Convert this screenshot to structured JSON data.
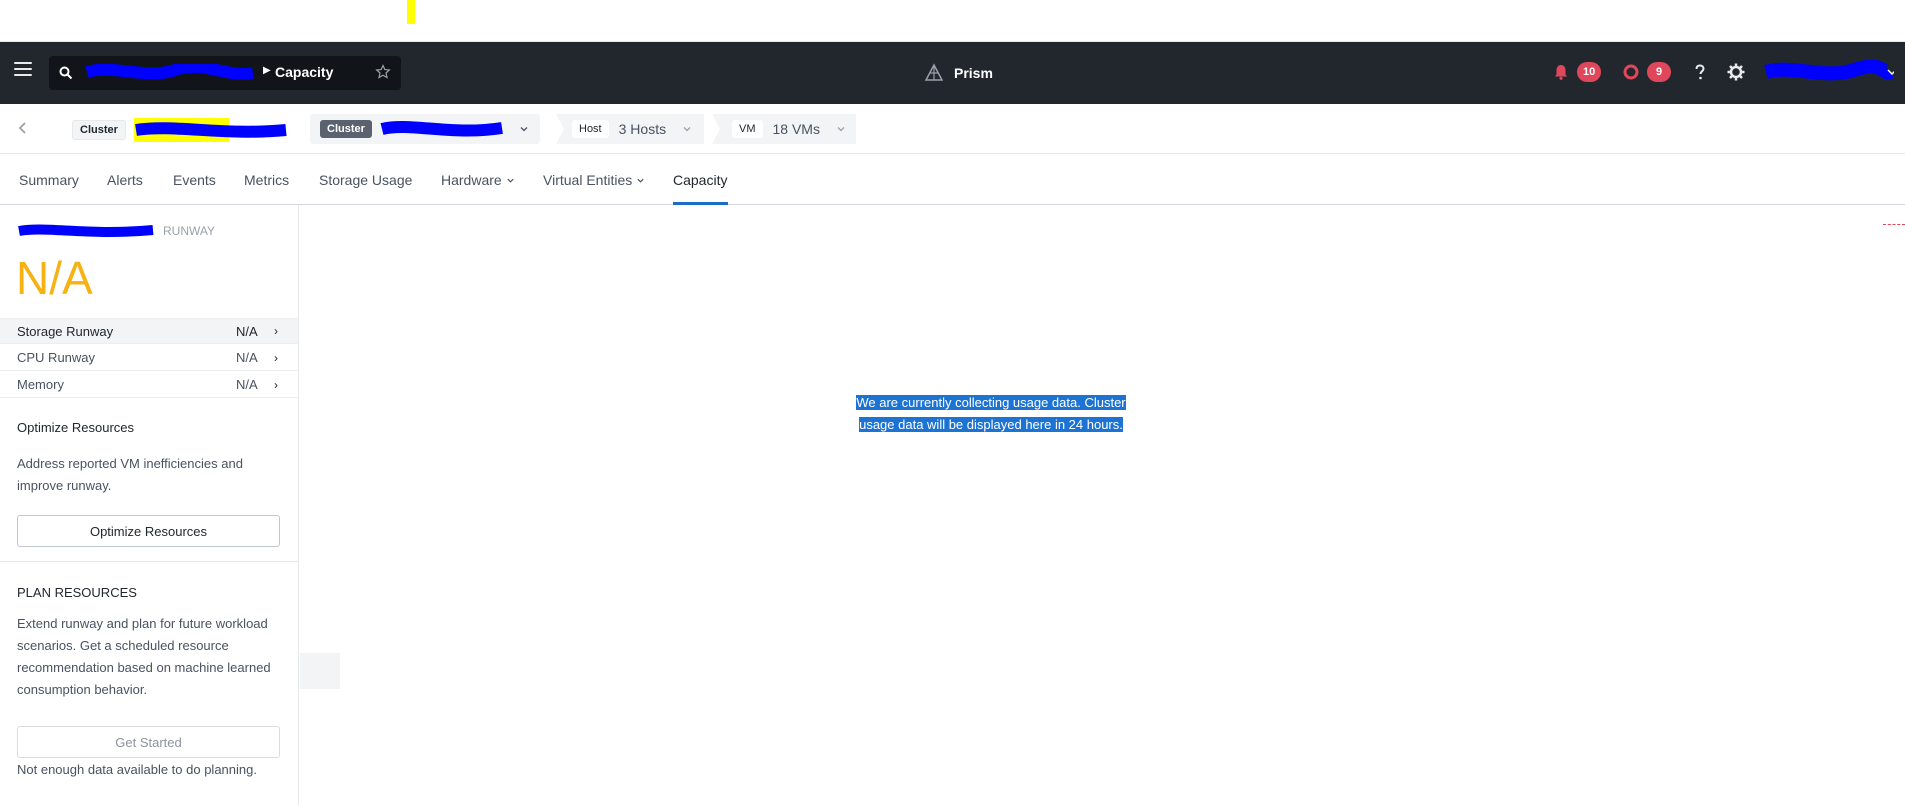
{
  "header": {
    "search_crumb": "Capacity",
    "brand": "Prism",
    "alerts_count": "10",
    "events_count": "9"
  },
  "entity_bar": {
    "cluster_label": "Cluster",
    "cluster2_label": "Cluster",
    "host_label": "Host",
    "host_value": "3 Hosts",
    "vm_label": "VM",
    "vm_value": "18 VMs"
  },
  "tabs": [
    {
      "label": "Summary"
    },
    {
      "label": "Alerts"
    },
    {
      "label": "Events"
    },
    {
      "label": "Metrics"
    },
    {
      "label": "Storage Usage"
    },
    {
      "label": "Hardware"
    },
    {
      "label": "Virtual Entities"
    },
    {
      "label": "Capacity",
      "active": true
    }
  ],
  "left_panel": {
    "runway_title": "RUNWAY",
    "runway_value": "N/A",
    "rows": [
      {
        "label": "Storage Runway",
        "value": "N/A"
      },
      {
        "label": "CPU Runway",
        "value": "N/A"
      },
      {
        "label": "Memory",
        "value": "N/A"
      }
    ],
    "optimize": {
      "title": "Optimize Resources",
      "text": "Address reported VM inefficiencies and improve runway.",
      "button": "Optimize Resources"
    },
    "plan": {
      "title": "PLAN RESOURCES",
      "text": "Extend runway and plan for future workload scenarios. Get a scheduled resource recommendation based on machine learned consumption behavior.",
      "button": "Get Started",
      "note": "Not enough data available to do planning."
    }
  },
  "main": {
    "message_line1": "We are currently collecting usage data. Cluster",
    "message_line2": "usage data will be displayed here in 24 hours."
  },
  "colors": {
    "header_bg": "#22272e",
    "accent": "#1b6dc6",
    "runway_value": "#f6b213",
    "badge": "#e0475a"
  }
}
